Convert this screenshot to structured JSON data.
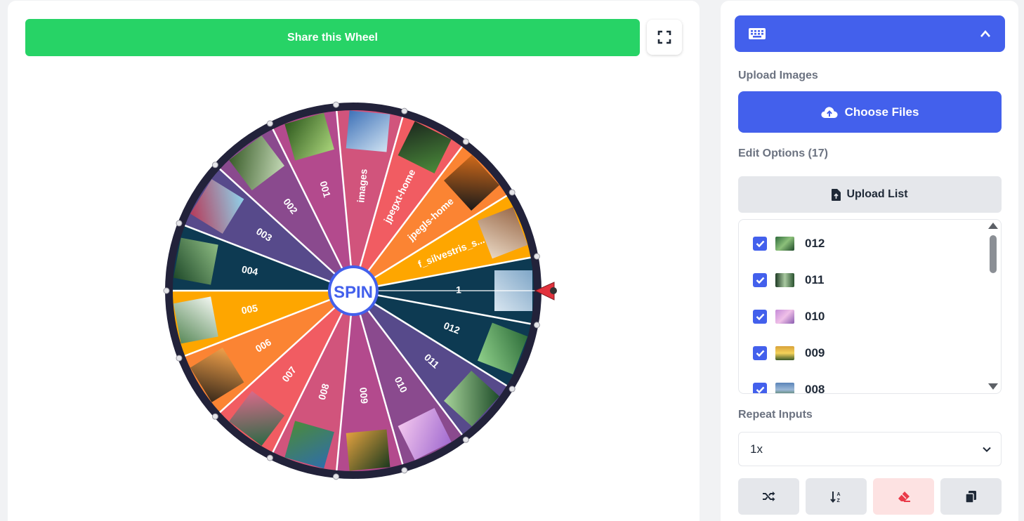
{
  "share_label": "Share this Wheel",
  "spin_label": "SPIN",
  "wheel": {
    "segments": [
      {
        "label": "1",
        "color": "#0d3a52"
      },
      {
        "label": "012",
        "color": "#0d3a52"
      },
      {
        "label": "011",
        "color": "#574a8b"
      },
      {
        "label": "010",
        "color": "#8a4a8e"
      },
      {
        "label": "009",
        "color": "#b34a8d"
      },
      {
        "label": "008",
        "color": "#d1547c"
      },
      {
        "label": "007",
        "color": "#f15c62"
      },
      {
        "label": "006",
        "color": "#fb8433"
      },
      {
        "label": "005",
        "color": "#fea600"
      },
      {
        "label": "004",
        "color": "#0d3a52"
      },
      {
        "label": "003",
        "color": "#574a8b"
      },
      {
        "label": "002",
        "color": "#8a4a8e"
      },
      {
        "label": "001",
        "color": "#b34a8d"
      },
      {
        "label": "images",
        "color": "#d1547c"
      },
      {
        "label": "jpegxt-home",
        "color": "#f15c62"
      },
      {
        "label": "jpegls-home",
        "color": "#fb8433"
      },
      {
        "label": "f_silvestris_s...",
        "color": "#fea600"
      }
    ],
    "pointer_color": "#e2323d"
  },
  "panel": {
    "upload_images_label": "Upload Images",
    "choose_files_label": "Choose Files",
    "edit_options_label": "Edit Options (17)",
    "upload_list_label": "Upload List",
    "options": [
      {
        "label": "012",
        "checked": true
      },
      {
        "label": "011",
        "checked": true
      },
      {
        "label": "010",
        "checked": true
      },
      {
        "label": "009",
        "checked": true
      },
      {
        "label": "008",
        "checked": true
      }
    ],
    "repeat_inputs_label": "Repeat Inputs",
    "repeat_value": "1x",
    "accent": "#4360ec"
  }
}
